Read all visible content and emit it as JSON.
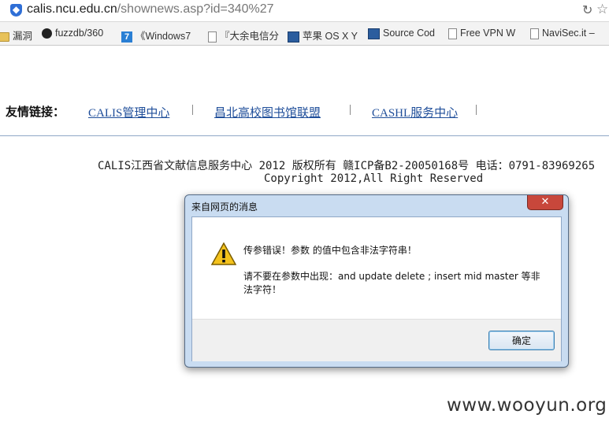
{
  "browser": {
    "url_host": "calis.ncu.edu.cn",
    "url_path": "/shownews.asp?id=340%27",
    "bookmarks": [
      {
        "icon": "folder-icon",
        "label": "漏洞"
      },
      {
        "icon": "github-icon",
        "label": "fuzzdb/360"
      },
      {
        "icon": "windows7-icon",
        "label": "《Windows7"
      },
      {
        "icon": "document-icon",
        "label": "『大余电信分"
      },
      {
        "icon": "site-icon",
        "label": "苹果 OS X Y"
      },
      {
        "icon": "site-icon",
        "label": "Source Cod"
      },
      {
        "icon": "document-icon",
        "label": "Free VPN W"
      },
      {
        "icon": "document-icon",
        "label": "NaviSec.it –"
      }
    ]
  },
  "page": {
    "friends_label": "友情链接：",
    "links": [
      "CALIS管理中心",
      "昌北高校图书馆联盟",
      "CASHL服务中心"
    ],
    "separator": "|",
    "footer_line1": "CALIS江西省文献信息服务中心 2012 版权所有 赣ICP备B2-20050168号 电话：0791-83969265",
    "footer_line2": "Copyright 2012,All Right Reserved"
  },
  "dialog": {
    "title": "来自网页的消息",
    "close": "✕",
    "message1": "传参错误！参数 的值中包含非法字符串！",
    "message2": "请不要在参数中出现：and update delete ; insert mid master 等非法字符！",
    "ok_label": "确定"
  },
  "watermark": "www.wooyun.org",
  "colors": {
    "link": "#1f4e9a",
    "dialog_frame": "#c9dcf1",
    "close_button": "#c8473b"
  }
}
